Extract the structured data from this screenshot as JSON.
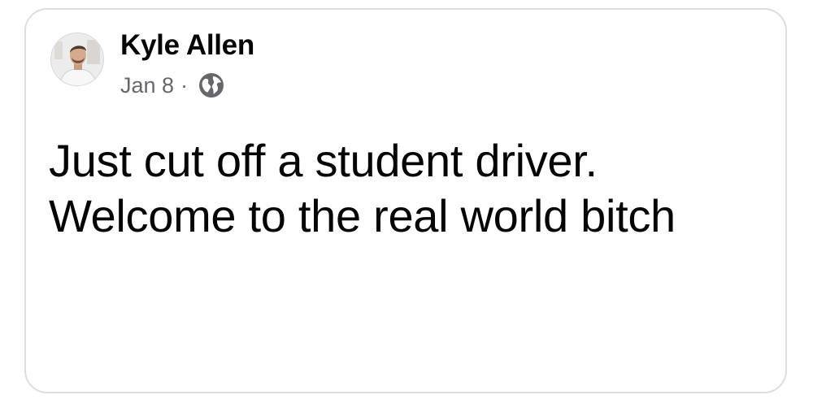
{
  "post": {
    "author": "Kyle Allen",
    "date": "Jan 8",
    "separator": "·",
    "privacy_icon": "globe-icon",
    "text": "Just cut off a student driver. Welcome to the real world bitch"
  },
  "colors": {
    "card_border": "#dcdde0",
    "name_text": "#050505",
    "meta_text": "#65676b",
    "body_text": "#050505"
  }
}
